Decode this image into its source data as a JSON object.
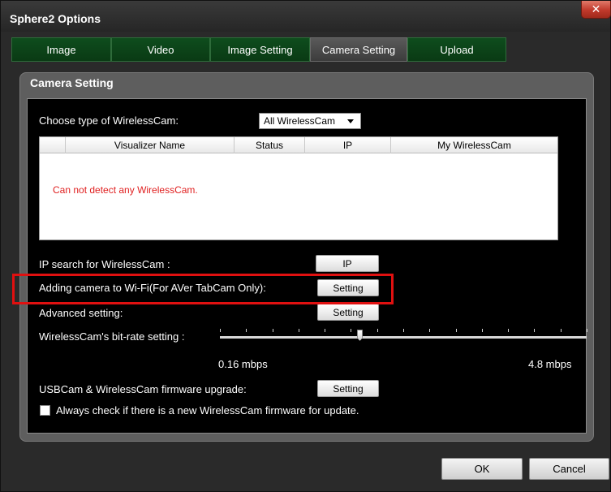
{
  "window": {
    "title": "Sphere2 Options",
    "close_symbol": "✕"
  },
  "tabs": [
    {
      "label": "Image",
      "active": false
    },
    {
      "label": "Video",
      "active": false
    },
    {
      "label": "Image Setting",
      "active": false
    },
    {
      "label": "Camera Setting",
      "active": true
    },
    {
      "label": "Upload",
      "active": false
    }
  ],
  "panel": {
    "title": "Camera Setting"
  },
  "camera_type": {
    "label": "Choose type of WirelessCam:",
    "selected": "All WirelessCam"
  },
  "table": {
    "columns": [
      "Visualizer Name",
      "Status",
      "IP",
      "My WirelessCam"
    ],
    "empty_message": "Can not detect any WirelessCam."
  },
  "settings": {
    "ip_search": {
      "label": "IP search for WirelessCam :",
      "button": "IP"
    },
    "add_wifi": {
      "label": "Adding camera to Wi-Fi(For AVer TabCam Only):",
      "button": "Setting"
    },
    "advanced": {
      "label": "Advanced setting:",
      "button": "Setting"
    },
    "bitrate": {
      "label": "WirelessCam's bit-rate setting :",
      "min_label": "0.16 mbps",
      "max_label": "4.8 mbps",
      "position_fraction": 0.38
    },
    "firmware": {
      "label": "USBCam & WirelessCam firmware upgrade:",
      "button": "Setting"
    },
    "auto_check": {
      "label": "Always check if there is a new WirelessCam firmware for update.",
      "checked": false
    }
  },
  "footer": {
    "ok": "OK",
    "cancel": "Cancel"
  },
  "colors": {
    "tab_inactive": "#0e4d1d",
    "highlight": "#e01010",
    "error_text": "#e02020"
  }
}
